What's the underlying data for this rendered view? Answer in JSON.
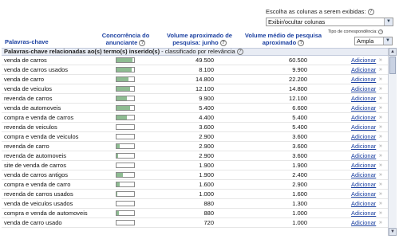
{
  "column_chooser": {
    "label": "Escolha as colunas a serem exibidas:",
    "help": "?",
    "select_value": "Exibir/ocultar colunas"
  },
  "match_type": {
    "label": "Tipo de correspondência:",
    "help": "?",
    "select_value": "Ampla"
  },
  "headers": {
    "keyword": "Palavras-chave",
    "competition": "Concorrência do anunciante",
    "volume": "Volume aproximado de pesquisa: junho",
    "avg_volume": "Volume médio de pesquisa aproximado"
  },
  "header_help": "?",
  "section": {
    "title": "Palavras-chave relacionadas ao(s) termo(s) inserido(s)",
    "subtitle": " - classificado por relevância",
    "help": "?"
  },
  "add_label": "Adicionar",
  "add_chevron": "»",
  "rows": [
    {
      "keyword": "venda de carros",
      "competition": 0.9,
      "volume": "49.500",
      "avg": "60.500"
    },
    {
      "keyword": "venda de carros usados",
      "competition": 0.85,
      "volume": "8.100",
      "avg": "9.900"
    },
    {
      "keyword": "venda de carro",
      "competition": 0.7,
      "volume": "14.800",
      "avg": "22.200"
    },
    {
      "keyword": "venda de veiculos",
      "competition": 0.75,
      "volume": "12.100",
      "avg": "14.800"
    },
    {
      "keyword": "revenda de carros",
      "competition": 0.6,
      "volume": "9.900",
      "avg": "12.100"
    },
    {
      "keyword": "venda de automoveis",
      "competition": 0.75,
      "volume": "5.400",
      "avg": "6.600"
    },
    {
      "keyword": "compra e venda de carros",
      "competition": 0.6,
      "volume": "4.400",
      "avg": "5.400"
    },
    {
      "keyword": "revenda de veiculos",
      "competition": 0.0,
      "volume": "3.600",
      "avg": "5.400"
    },
    {
      "keyword": "compra e venda de veiculos",
      "competition": 0.0,
      "volume": "2.900",
      "avg": "3.600"
    },
    {
      "keyword": "revenda de carro",
      "competition": 0.2,
      "volume": "2.900",
      "avg": "3.600"
    },
    {
      "keyword": "revenda de automoveis",
      "competition": 0.1,
      "volume": "2.900",
      "avg": "3.600"
    },
    {
      "keyword": "site de venda de carros",
      "competition": 0.0,
      "volume": "1.900",
      "avg": "1.900"
    },
    {
      "keyword": "venda de carros antigos",
      "competition": 0.35,
      "volume": "1.900",
      "avg": "2.400"
    },
    {
      "keyword": "compra e venda de carro",
      "competition": 0.2,
      "volume": "1.600",
      "avg": "2.900"
    },
    {
      "keyword": "revenda de carros usados",
      "competition": 0.05,
      "volume": "1.000",
      "avg": "1.600"
    },
    {
      "keyword": "venda de veiculos usados",
      "competition": 0.0,
      "volume": "880",
      "avg": "1.300"
    },
    {
      "keyword": "compra e venda de automoveis",
      "competition": 0.15,
      "volume": "880",
      "avg": "1.000"
    },
    {
      "keyword": "venda de carro usado",
      "competition": 0.0,
      "volume": "720",
      "avg": "1.000"
    }
  ],
  "scrollbar": {
    "up": "▲",
    "down": "▼"
  },
  "select_arrow": "▼"
}
